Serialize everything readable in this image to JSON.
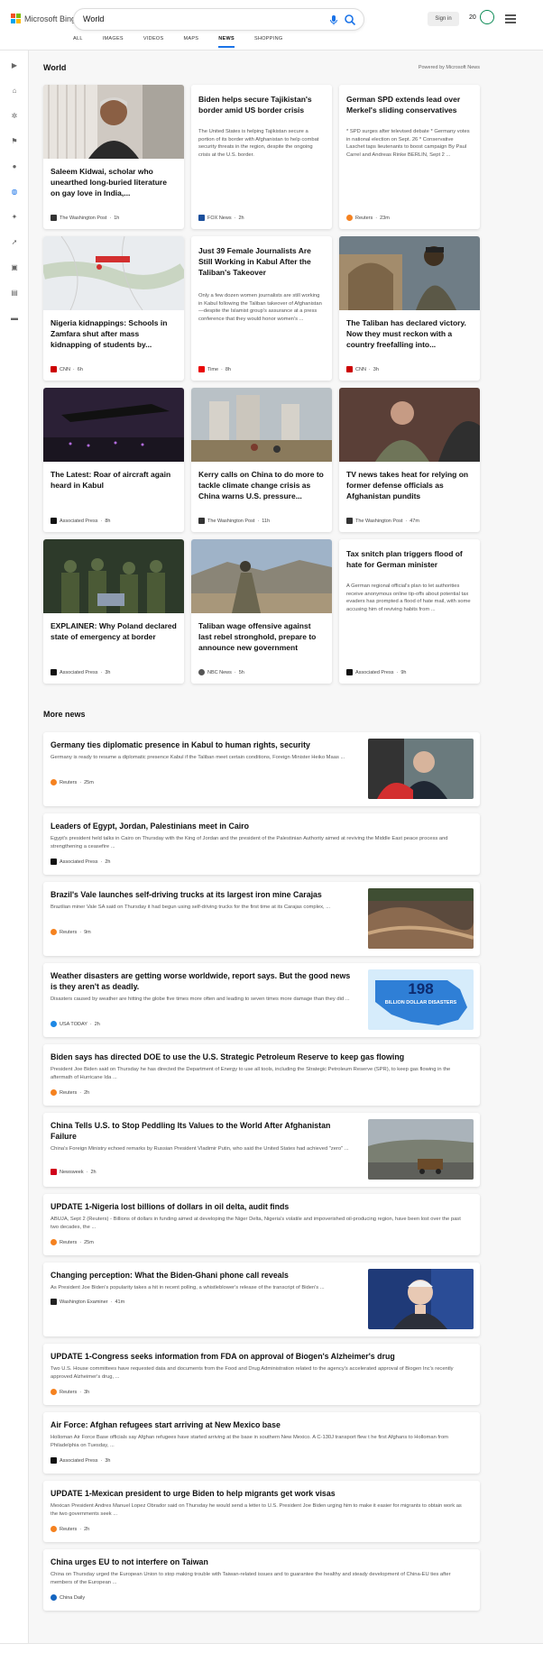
{
  "header": {
    "logo_text": "Microsoft Bing",
    "search_value": "World",
    "signin_label": "Sign in",
    "points": "20"
  },
  "tabs": [
    "ALL",
    "IMAGES",
    "VIDEOS",
    "MAPS",
    "NEWS",
    "SHOPPING"
  ],
  "active_tab": "NEWS",
  "world": {
    "title": "World",
    "powered_by": "Powered by Microsoft News",
    "cards": [
      {
        "title": "Saleem Kidwai, scholar who unearthed long-buried literature on gay love in India,...",
        "snippet": "",
        "source": "The Washington Post",
        "time": "1h",
        "logo_color": "#333333"
      },
      {
        "title": "Biden helps secure Tajikistan's border amid US border crisis",
        "snippet": "The United States is helping Tajikistan secure a portion of its border with Afghanistan to help combat security threats in the region, despite the ongoing crisis at the U.S. border.",
        "source": "FOX News",
        "time": "2h",
        "logo_color": "#1b4f9c"
      },
      {
        "title": "German SPD extends lead over Merkel's sliding conservatives",
        "snippet": "* SPD surges after televised debate * Germany votes in national election on Sept. 26 * Conservative Laschet taps lieutenants to boost campaign By Paul Carrel and Andreas Rinke BERLIN, Sept 2 ...",
        "source": "Reuters",
        "time": "23m",
        "logo_color": "#f58220"
      },
      {
        "title": "Nigeria kidnappings: Schools in Zamfara shut after mass kidnapping of students by...",
        "snippet": "",
        "source": "CNN",
        "time": "6h",
        "logo_color": "#cc0000"
      },
      {
        "title": "Just 39 Female Journalists Are Still Working in Kabul After the Taliban's Takeover",
        "snippet": "Only a few dozen women journalists are still working in Kabul following the Taliban takeover of Afghanistan—despite the Islamist group's assurance at a press conference that they would honor women's ...",
        "source": "Time",
        "time": "8h",
        "logo_color": "#e90606"
      },
      {
        "title": "The Taliban has declared victory. Now they must reckon with a country freefalling into...",
        "snippet": "",
        "source": "CNN",
        "time": "3h",
        "logo_color": "#cc0000"
      },
      {
        "title": "The Latest: Roar of aircraft again heard in Kabul",
        "snippet": "",
        "source": "Associated Press",
        "time": "8h",
        "logo_color": "#111111"
      },
      {
        "title": "Kerry calls on China to do more to tackle climate change crisis as China warns U.S. pressure...",
        "snippet": "",
        "source": "The Washington Post",
        "time": "11h",
        "logo_color": "#333333"
      },
      {
        "title": "TV news takes heat for relying on former defense officials as Afghanistan pundits",
        "snippet": "",
        "source": "The Washington Post",
        "time": "47m",
        "logo_color": "#333333"
      },
      {
        "title": "EXPLAINER: Why Poland declared state of emergency at border",
        "snippet": "",
        "source": "Associated Press",
        "time": "3h",
        "logo_color": "#111111"
      },
      {
        "title": "Taliban wage offensive against last rebel stronghold, prepare to announce new government",
        "snippet": "",
        "source": "NBC News",
        "time": "5h",
        "logo_color": "#555555"
      },
      {
        "title": "Tax snitch plan triggers flood of hate for German minister",
        "snippet": "A German regional official's plan to let authorities receive anonymous online tip-offs about potential tax evaders has prompted a flood of hate mail, with some accusing him of reviving habits from ...",
        "source": "Associated Press",
        "time": "9h",
        "logo_color": "#111111"
      }
    ]
  },
  "more": {
    "title": "More news",
    "items": [
      {
        "title": "Germany ties diplomatic presence in Kabul to human rights, security",
        "snippet": "Germany is ready to resume a diplomatic presence Kabul if the Taliban meet certain conditions, Foreign Minister Heiko Maas ...",
        "source": "Reuters",
        "time": "25m",
        "logo_color": "#f58220",
        "thumb": "minister"
      },
      {
        "title": "Leaders of Egypt, Jordan, Palestinians meet in Cairo",
        "snippet": "Egypt's president held talks in Cairo on Thursday with the King of Jordan and the president of the Palestinian Authority aimed at reviving the Middle East peace process and strengthening a ceasefire ...",
        "source": "Associated Press",
        "time": "2h",
        "logo_color": "#111111",
        "thumb": ""
      },
      {
        "title": "Brazil's Vale launches self-driving trucks at its largest iron mine Carajas",
        "snippet": "Brazilian miner Vale SA said on Thursday it had begun using self-driving trucks for the first time at its Carajas complex, ...",
        "source": "Reuters",
        "time": "9m",
        "logo_color": "#f58220",
        "thumb": "mine"
      },
      {
        "title": "Weather disasters are getting worse worldwide, report says. But the good news is they aren't as deadly.",
        "snippet": "Disasters caused by weather are hitting the globe five times more often and leading to seven times more damage than they did ...",
        "source": "USA TODAY",
        "time": "2h",
        "logo_color": "#1e88e5",
        "thumb": "map",
        "thumb_number": "198",
        "thumb_caption": "BILLION DOLLAR DISASTERS"
      },
      {
        "title": "Biden says has directed DOE to use the U.S. Strategic Petroleum Reserve to keep gas flowing",
        "snippet": "President Joe Biden said on Thursday he has directed the Department of Energy to use all tools, including the Strategic Petroleum Reserve (SPR), to keep gas flowing in the aftermath of Hurricane Ida ...",
        "source": "Reuters",
        "time": "2h",
        "logo_color": "#f58220",
        "thumb": ""
      },
      {
        "title": "China Tells U.S. to Stop Peddling Its Values to the World After Afghanistan Failure",
        "snippet": "China's Foreign Ministry echoed remarks by Russian President Vladimir Putin, who said the United States had achieved \"zero\" ...",
        "source": "Newsweek",
        "time": "2h",
        "logo_color": "#d0021b",
        "thumb": "airfield"
      },
      {
        "title": "UPDATE 1-Nigeria lost billions of dollars in oil delta, audit finds",
        "snippet": "ABUJA, Sept 2 (Reuters) - Billions of dollars in funding aimed at developing the Niger Delta, Nigeria's volatile and impoverished oil-producing region, have been lost over the past two decades, the ...",
        "source": "Reuters",
        "time": "25m",
        "logo_color": "#f58220",
        "thumb": ""
      },
      {
        "title": "Changing perception: What the Biden-Ghani phone call reveals",
        "snippet": "As President Joe Biden's popularity takes a hit in recent polling, a whistleblower's release of the transcript of Biden's ...",
        "source": "Washington Examiner",
        "time": "41m",
        "logo_color": "#222222",
        "thumb": "biden"
      },
      {
        "title": "UPDATE 1-Congress seeks information from FDA on approval of Biogen's Alzheimer's drug",
        "snippet": "Two U.S. House committees have requested data and documents from the Food and Drug Administration related to the agency's accelerated approval of Biogen Inc's recently approved Alzheimer's drug, ...",
        "source": "Reuters",
        "time": "3h",
        "logo_color": "#f58220",
        "thumb": ""
      },
      {
        "title": "Air Force: Afghan refugees start arriving at New Mexico base",
        "snippet": "Holloman Air Force Base officials say Afghan refugees have started arriving at the base in southern New Mexico. A C-130J transport flew t he first Afghans to Holloman from Philadelphia on Tuesday, ...",
        "source": "Associated Press",
        "time": "3h",
        "logo_color": "#111111",
        "thumb": ""
      },
      {
        "title": "UPDATE 1-Mexican president to urge Biden to help migrants get work visas",
        "snippet": "Mexican President Andres Manuel Lopez Obrador said on Thursday he would send a letter to U.S. President Joe Biden urging him to make it easier for migrants to obtain work as the two governments seek ...",
        "source": "Reuters",
        "time": "2h",
        "logo_color": "#f58220",
        "thumb": ""
      },
      {
        "title": "China urges EU to not interfere on Taiwan",
        "snippet": "China on Thursday urged the European Union to stop making trouble with Taiwan-related issues and to guarantee the healthy and steady development of China-EU ties after members of the European ...",
        "source": "China Daily",
        "time": "",
        "logo_color": "#1565c0",
        "thumb": ""
      }
    ]
  }
}
